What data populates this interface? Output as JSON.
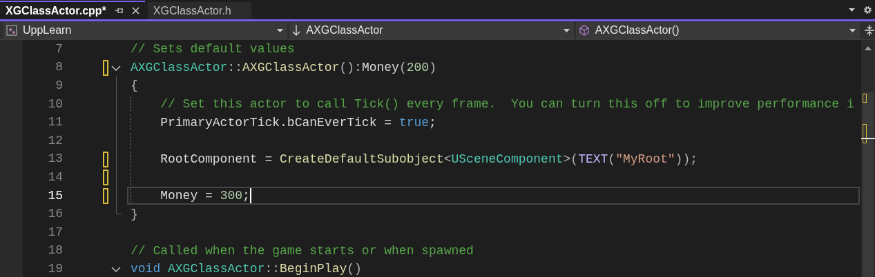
{
  "tabs": [
    {
      "label": "XGClassActor.cpp*",
      "selected": true,
      "pinned": true,
      "closable": true
    },
    {
      "label": "XGClassActor.h",
      "selected": false,
      "pinned": false,
      "closable": false
    }
  ],
  "navigation": [
    {
      "kind": "project",
      "label": "UppLearn"
    },
    {
      "kind": "scope",
      "label": "AXGClassActor"
    },
    {
      "kind": "member",
      "label": "AXGClassActor()"
    }
  ],
  "editor": {
    "lines": [
      {
        "number": "7",
        "current": false,
        "changed": false,
        "fold": false,
        "scope_guide": false,
        "scope_end": false,
        "indent_guide": false,
        "tokens": [
          {
            "kind": "comment",
            "text": "// Sets default values"
          }
        ]
      },
      {
        "number": "8",
        "current": false,
        "changed": true,
        "fold": true,
        "scope_guide": false,
        "scope_end": false,
        "indent_guide": false,
        "tokens": [
          {
            "kind": "type",
            "text": "AXGClassActor"
          },
          {
            "kind": "punct",
            "text": "::"
          },
          {
            "kind": "func",
            "text": "AXGClassActor"
          },
          {
            "kind": "punct",
            "text": "():"
          },
          {
            "kind": "plain",
            "text": "Money"
          },
          {
            "kind": "punct",
            "text": "("
          },
          {
            "kind": "number",
            "text": "200"
          },
          {
            "kind": "punct",
            "text": ")"
          }
        ]
      },
      {
        "number": "9",
        "current": false,
        "changed": false,
        "fold": false,
        "scope_guide": true,
        "scope_end": false,
        "indent_guide": false,
        "tokens": [
          {
            "kind": "punct",
            "text": "{"
          }
        ]
      },
      {
        "number": "10",
        "current": false,
        "changed": false,
        "fold": false,
        "scope_guide": true,
        "scope_end": false,
        "indent_guide": true,
        "tokens": [
          {
            "kind": "comment",
            "text": "    // Set this actor to call Tick() every frame.  You can turn this off to improve performance i"
          }
        ]
      },
      {
        "number": "11",
        "current": false,
        "changed": false,
        "fold": false,
        "scope_guide": true,
        "scope_end": false,
        "indent_guide": true,
        "tokens": [
          {
            "kind": "plain",
            "text": "    PrimaryActorTick.bCanEverTick = "
          },
          {
            "kind": "keyword",
            "text": "true"
          },
          {
            "kind": "plain",
            "text": ";"
          }
        ]
      },
      {
        "number": "12",
        "current": false,
        "changed": false,
        "fold": false,
        "scope_guide": true,
        "scope_end": false,
        "indent_guide": true
      },
      {
        "number": "13",
        "current": false,
        "changed": true,
        "fold": false,
        "scope_guide": true,
        "scope_end": false,
        "indent_guide": true,
        "tokens": [
          {
            "kind": "plain",
            "text": "    RootComponent = "
          },
          {
            "kind": "func",
            "text": "CreateDefaultSubobject"
          },
          {
            "kind": "punct",
            "text": "<"
          },
          {
            "kind": "type",
            "text": "USceneComponent"
          },
          {
            "kind": "punct",
            "text": ">("
          },
          {
            "kind": "macro",
            "text": "TEXT"
          },
          {
            "kind": "punct",
            "text": "("
          },
          {
            "kind": "string",
            "text": "\"MyRoot\""
          },
          {
            "kind": "punct",
            "text": "));"
          }
        ]
      },
      {
        "number": "14",
        "current": false,
        "changed": true,
        "fold": false,
        "scope_guide": true,
        "scope_end": false,
        "indent_guide": true
      },
      {
        "number": "15",
        "current": true,
        "changed": true,
        "fold": false,
        "scope_guide": true,
        "scope_end": false,
        "indent_guide": true,
        "tokens": [
          {
            "kind": "plain",
            "text": "    Money = "
          },
          {
            "kind": "number",
            "text": "300"
          },
          {
            "kind": "plain",
            "text": ";"
          }
        ]
      },
      {
        "number": "16",
        "current": false,
        "changed": false,
        "fold": false,
        "scope_guide": false,
        "scope_end": true,
        "indent_guide": false,
        "tokens": [
          {
            "kind": "punct",
            "text": "}"
          }
        ]
      },
      {
        "number": "17",
        "current": false,
        "changed": false,
        "fold": false,
        "scope_guide": false,
        "scope_end": false,
        "indent_guide": false
      },
      {
        "number": "18",
        "current": false,
        "changed": false,
        "fold": false,
        "scope_guide": false,
        "scope_end": false,
        "indent_guide": false,
        "tokens": [
          {
            "kind": "comment",
            "text": "// Called when the game starts or when spawned"
          }
        ]
      },
      {
        "number": "19",
        "current": false,
        "changed": false,
        "fold": true,
        "scope_guide": false,
        "scope_end": false,
        "indent_guide": false,
        "tokens": [
          {
            "kind": "keyword",
            "text": "void "
          },
          {
            "kind": "type",
            "text": "AXGClassActor"
          },
          {
            "kind": "punct",
            "text": "::"
          },
          {
            "kind": "func",
            "text": "BeginPlay"
          },
          {
            "kind": "punct",
            "text": "()"
          }
        ]
      }
    ]
  }
}
